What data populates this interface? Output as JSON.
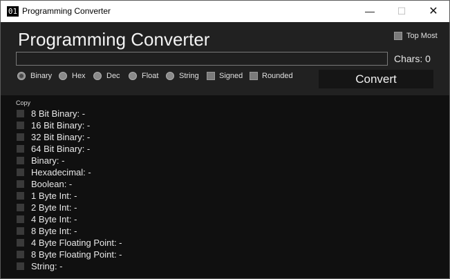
{
  "window": {
    "title": "Programming Converter",
    "icon_text": "01",
    "controls": {
      "minimize": "—",
      "maximize": "☐",
      "close": "✕"
    }
  },
  "header": {
    "title": "Programming Converter",
    "chars_label": "Chars: 0",
    "top_most_label": "Top Most",
    "input_value": ""
  },
  "options": {
    "radios": [
      {
        "label": "Binary",
        "checked": true
      },
      {
        "label": "Hex",
        "checked": false
      },
      {
        "label": "Dec",
        "checked": false
      },
      {
        "label": "Float",
        "checked": false
      },
      {
        "label": "String",
        "checked": false
      }
    ],
    "checkboxes": [
      {
        "label": "Signed",
        "checked": false
      },
      {
        "label": "Rounded",
        "checked": false
      }
    ],
    "convert_label": "Convert"
  },
  "results": {
    "copy_label": "Copy",
    "rows": [
      "8 Bit Binary: -",
      "16 Bit Binary: -",
      "32 Bit Binary: -",
      "64 Bit Binary: -",
      "Binary: -",
      "Hexadecimal: -",
      "Boolean: -",
      "1 Byte Int: -",
      "2 Byte Int: -",
      "4 Byte Int: -",
      "8 Byte Int: -",
      "4 Byte Floating Point: -",
      "8 Byte Floating Point: -",
      "String: -"
    ]
  }
}
